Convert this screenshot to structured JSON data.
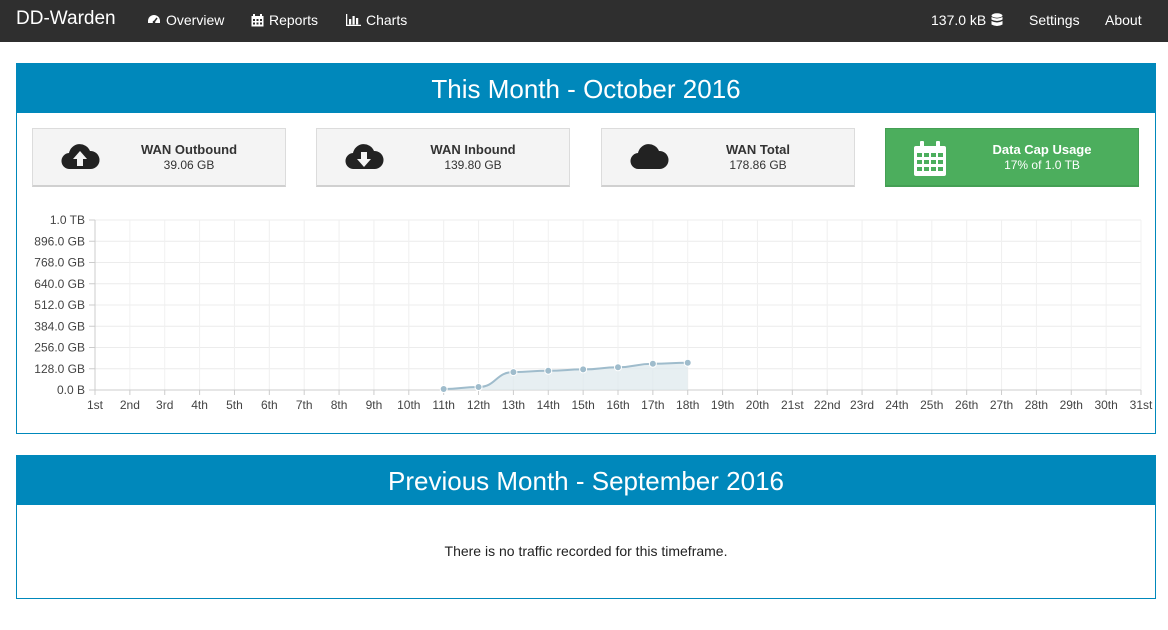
{
  "navbar": {
    "brand": "DD-Warden",
    "items": [
      {
        "label": "Overview",
        "icon": "dashboard-icon"
      },
      {
        "label": "Reports",
        "icon": "calendar-icon"
      },
      {
        "label": "Charts",
        "icon": "bar-chart-icon"
      }
    ],
    "usage": "137.0 kB",
    "usage_icon": "database-icon",
    "settings": "Settings",
    "about": "About"
  },
  "this_month": {
    "heading": "This Month - October 2016",
    "stats": [
      {
        "title": "WAN Outbound",
        "value": "39.06 GB",
        "icon": "cloud-upload-icon"
      },
      {
        "title": "WAN Inbound",
        "value": "139.80 GB",
        "icon": "cloud-download-icon"
      },
      {
        "title": "WAN Total",
        "value": "178.86 GB",
        "icon": "cloud-icon"
      },
      {
        "title": "Data Cap Usage",
        "value": "17% of 1.0 TB",
        "icon": "calendar-icon"
      }
    ]
  },
  "previous_month": {
    "heading": "Previous Month - September 2016",
    "message": "There is no traffic recorded for this timeframe."
  },
  "colors": {
    "navbar": "#2f2f2f",
    "panel_accent": "#0088bb",
    "datacap_green": "#4cae5d",
    "line": "#9fbccc"
  },
  "chart_data": {
    "type": "area",
    "x": [
      "1st",
      "2nd",
      "3rd",
      "4th",
      "5th",
      "6th",
      "7th",
      "8th",
      "9th",
      "10th",
      "11th",
      "12th",
      "13th",
      "14th",
      "15th",
      "16th",
      "17th",
      "18th",
      "19th",
      "20th",
      "21st",
      "22nd",
      "23rd",
      "24th",
      "25th",
      "26th",
      "27th",
      "28th",
      "29th",
      "30th",
      "31st"
    ],
    "series": [
      {
        "values_gb": [
          null,
          null,
          null,
          null,
          null,
          null,
          null,
          null,
          null,
          null,
          6,
          18,
          108,
          116,
          124,
          137,
          158,
          164,
          null,
          null,
          null,
          null,
          null,
          null,
          null,
          null,
          null,
          null,
          null,
          null,
          null
        ]
      }
    ],
    "y_ticks": [
      "0.0 B",
      "128.0 GB",
      "256.0 GB",
      "384.0 GB",
      "512.0 GB",
      "640.0 GB",
      "768.0 GB",
      "896.0 GB",
      "1.0 TB"
    ],
    "ylim_gb": [
      0,
      1024
    ],
    "grid": true
  }
}
